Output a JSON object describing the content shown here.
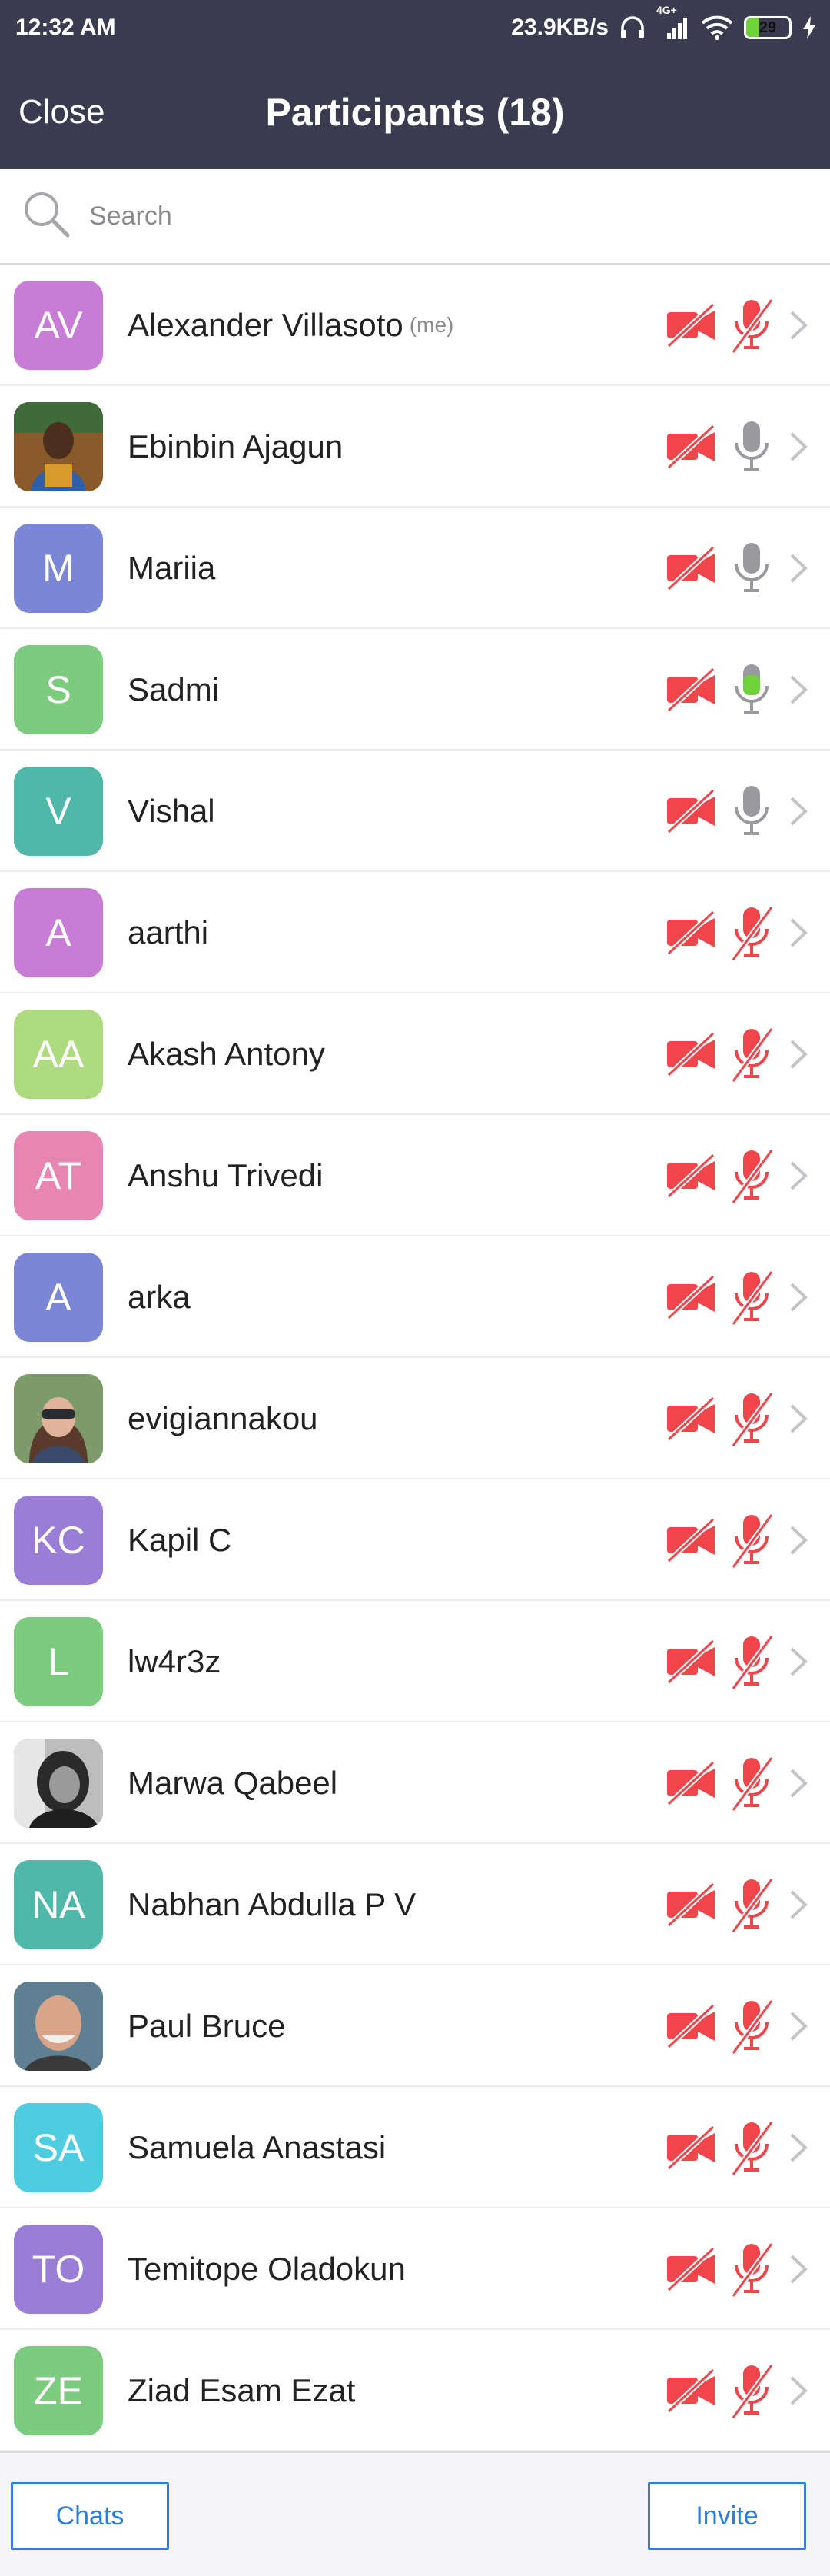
{
  "status_bar": {
    "time": "12:32 AM",
    "speed": "23.9KB/s",
    "network": "4G+",
    "battery": "29",
    "battery_level": 0.29
  },
  "header": {
    "close_label": "Close",
    "title": "Participants (18)"
  },
  "search": {
    "placeholder": "Search",
    "value": ""
  },
  "participants": [
    {
      "name": "Alexander Villasoto",
      "initials": "AV",
      "color": "#c77dd6",
      "me": "(me)",
      "mic": "muted",
      "video": "off"
    },
    {
      "name": "Ebinbin Ajagun",
      "initials": "",
      "photo": "photo-ebinbin",
      "color": "#6a7a3a",
      "mic": "on",
      "video": "off"
    },
    {
      "name": "Mariia",
      "initials": "M",
      "color": "#7b86d6",
      "mic": "on",
      "video": "off"
    },
    {
      "name": "Sadmi",
      "initials": "S",
      "color": "#7ccb7f",
      "mic": "speaking",
      "video": "off"
    },
    {
      "name": "Vishal",
      "initials": "V",
      "color": "#4fb8a9",
      "mic": "on",
      "video": "off"
    },
    {
      "name": "aarthi",
      "initials": "A",
      "color": "#c77dd6",
      "mic": "muted",
      "video": "off"
    },
    {
      "name": "Akash Antony",
      "initials": "AA",
      "color": "#aedb7f",
      "mic": "muted",
      "video": "off"
    },
    {
      "name": "Anshu Trivedi",
      "initials": "AT",
      "color": "#e886b3",
      "mic": "muted",
      "video": "off"
    },
    {
      "name": "arka",
      "initials": "A",
      "color": "#7b86d6",
      "mic": "muted",
      "video": "off"
    },
    {
      "name": "evigiannakou",
      "initials": "",
      "photo": "photo-evigiannakou",
      "color": "#8a6a55",
      "mic": "muted",
      "video": "off"
    },
    {
      "name": "Kapil C",
      "initials": "KC",
      "color": "#9a7dd6",
      "mic": "muted",
      "video": "off"
    },
    {
      "name": "lw4r3z",
      "initials": "L",
      "color": "#7ccb7f",
      "mic": "muted",
      "video": "off"
    },
    {
      "name": "Marwa Qabeel",
      "initials": "",
      "photo": "photo-marwa",
      "color": "#555555",
      "mic": "muted",
      "video": "off"
    },
    {
      "name": "Nabhan Abdulla P V",
      "initials": "NA",
      "color": "#4fb8a9",
      "mic": "muted",
      "video": "off"
    },
    {
      "name": "Paul Bruce",
      "initials": "",
      "photo": "photo-paul",
      "color": "#7a8f9a",
      "mic": "muted",
      "video": "off"
    },
    {
      "name": "Samuela Anastasi",
      "initials": "SA",
      "color": "#4fcde0",
      "mic": "muted",
      "video": "off"
    },
    {
      "name": "Temitope Oladokun",
      "initials": "TO",
      "color": "#9a7dd6",
      "mic": "muted",
      "video": "off"
    },
    {
      "name": "Ziad Esam Ezat",
      "initials": "ZE",
      "color": "#7ccb7f",
      "mic": "muted",
      "video": "off"
    }
  ],
  "colors": {
    "header_bg": "#3b3b4f",
    "muted_red": "#f0464b",
    "mic_gray": "#9a9a9e",
    "speaking_green": "#6fd23a",
    "button_blue": "#2d7ee0"
  },
  "footer": {
    "chats_label": "Chats",
    "invite_label": "Invite"
  }
}
